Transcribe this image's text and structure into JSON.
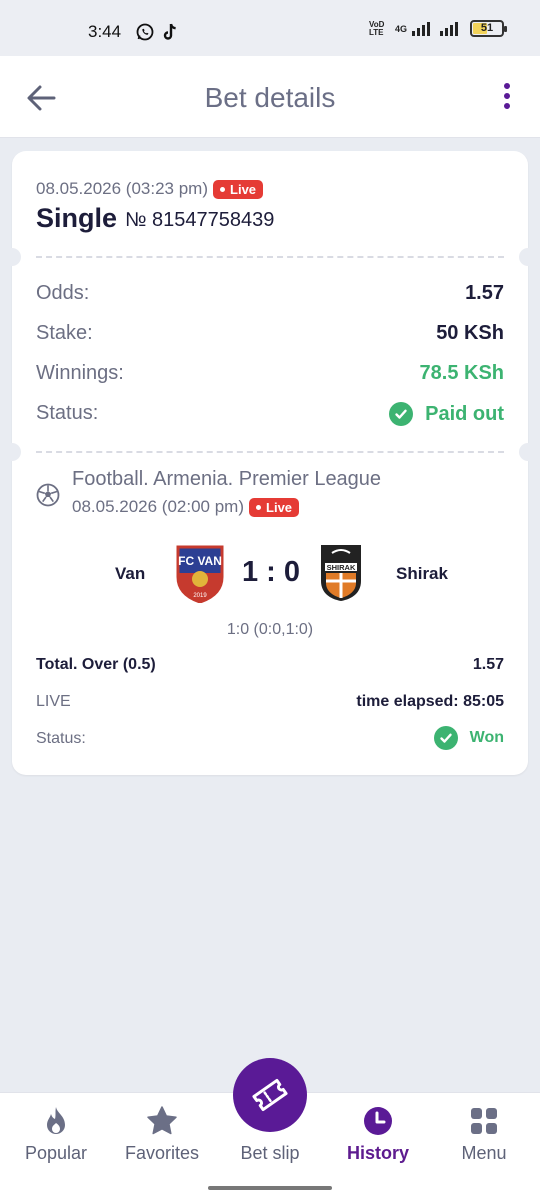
{
  "status_bar": {
    "time": "3:44",
    "volte_label": "VoD LTE",
    "network": "4G",
    "battery": "51"
  },
  "header": {
    "title": "Bet details",
    "back_icon": "arrow-left-icon",
    "menu_icon": "more-vertical-icon"
  },
  "bet": {
    "datetime": "08.05.2026 (03:23 pm)",
    "live_badge": "Live",
    "type": "Single",
    "number": "№ 81547758439",
    "rows": {
      "odds_label": "Odds:",
      "odds_value": "1.57",
      "stake_label": "Stake:",
      "stake_value": "50 KSh",
      "winnings_label": "Winnings:",
      "winnings_value": "78.5 KSh",
      "status_label": "Status:",
      "status_value": "Paid out"
    }
  },
  "event": {
    "league": "Football. Armenia. Premier League",
    "datetime": "08.05.2026 (02:00 pm)",
    "live_badge": "Live",
    "home_team": "Van",
    "away_team": "Shirak",
    "score": "1 : 0",
    "score_detail": "1:0 (0:0,1:0)",
    "market_label": "Total. Over (0.5)",
    "market_odds": "1.57",
    "live_label": "LIVE",
    "time_elapsed": "time elapsed: 85:05",
    "status_label": "Status:",
    "status_value": "Won"
  },
  "bottom_nav": {
    "items": [
      {
        "label": "Popular",
        "icon": "flame-icon"
      },
      {
        "label": "Favorites",
        "icon": "star-icon"
      },
      {
        "label": "Bet slip",
        "icon": "ticket-icon"
      },
      {
        "label": "History",
        "icon": "clock-icon"
      },
      {
        "label": "Menu",
        "icon": "grid-icon"
      }
    ],
    "active": "History"
  },
  "colors": {
    "accent": "#5a1a96",
    "live_red": "#e53b35",
    "win_green": "#3cb371",
    "text_dark": "#1d1d3a",
    "text_muted": "#6c6f83"
  }
}
